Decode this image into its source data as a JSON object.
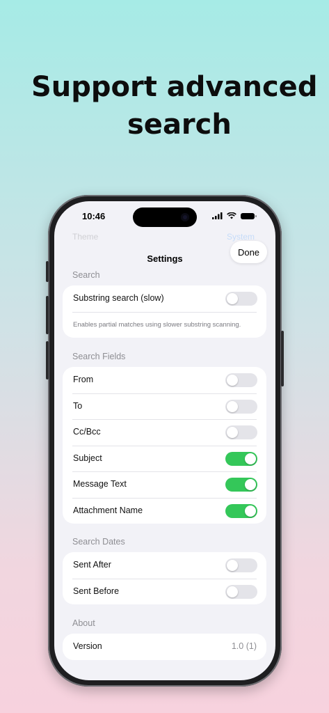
{
  "headline": {
    "line1": "Support advanced",
    "line2": "search"
  },
  "status_bar": {
    "time": "10:46",
    "icons": [
      "signal-icon",
      "wifi-icon",
      "battery-icon"
    ]
  },
  "background_faded": {
    "left": "Theme",
    "right": "System"
  },
  "nav": {
    "title": "Settings",
    "done_label": "Done"
  },
  "sections": {
    "search": {
      "header": "Search",
      "rows": [
        {
          "label": "Substring search (slow)",
          "on": false
        }
      ],
      "footnote": "Enables partial matches using slower substring scanning."
    },
    "search_fields": {
      "header": "Search Fields",
      "rows": [
        {
          "label": "From",
          "on": false
        },
        {
          "label": "To",
          "on": false
        },
        {
          "label": "Cc/Bcc",
          "on": false
        },
        {
          "label": "Subject",
          "on": true
        },
        {
          "label": "Message Text",
          "on": true
        },
        {
          "label": "Attachment Name",
          "on": true
        }
      ]
    },
    "search_dates": {
      "header": "Search Dates",
      "rows": [
        {
          "label": "Sent After",
          "on": false
        },
        {
          "label": "Sent Before",
          "on": false
        }
      ]
    },
    "about": {
      "header": "About",
      "rows": [
        {
          "label": "Version",
          "value": "1.0 (1)"
        }
      ]
    }
  },
  "colors": {
    "toggle_on": "#34c759",
    "toggle_off": "#e4e4e9",
    "group_bg": "#f2f2f7",
    "accent": "#007aff"
  }
}
